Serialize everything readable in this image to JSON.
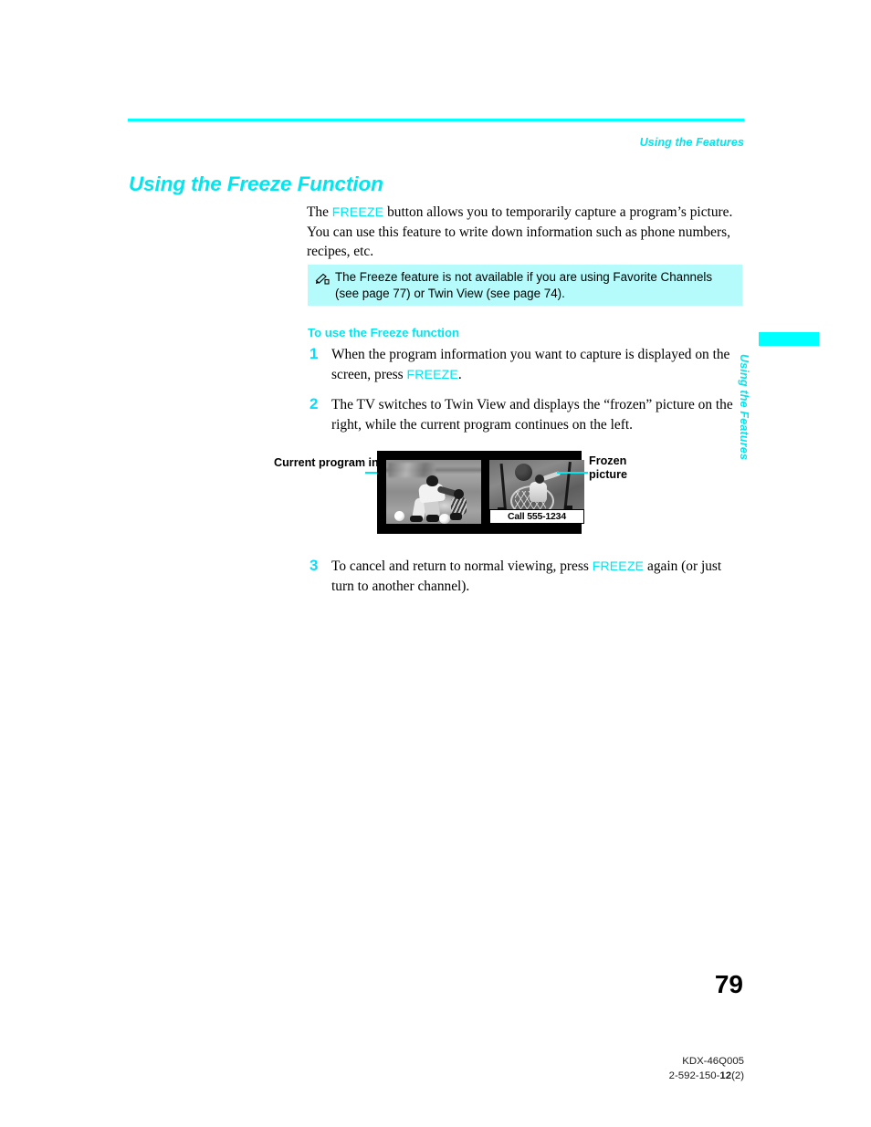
{
  "header": {
    "running_head": "Using the Features",
    "rule_color": "#00ffff"
  },
  "title": "Using the Freeze Function",
  "intro": {
    "part1": "The ",
    "keyword": "FREEZE",
    "part2": " button allows you to temporarily capture a program’s picture. You can use this feature to write down information such as phone numbers, recipes, etc."
  },
  "note": {
    "icon": "pencil-note-icon",
    "text": "The Freeze feature is not available if you are using Favorite Channels (see page 77) or Twin View (see page 74).",
    "background": "#b5fbfb"
  },
  "subhead": "To use the Freeze function",
  "steps": [
    {
      "number": "1",
      "text_before": "When the program information you want to capture is displayed on the screen, press ",
      "keyword": "FREEZE",
      "text_after": "."
    },
    {
      "number": "2",
      "text_before": "The TV switches to Twin View and displays the “frozen” picture on the right, while the current program continues on the left.",
      "keyword": "",
      "text_after": ""
    },
    {
      "number": "3",
      "text_before": "To cancel and return to normal viewing, press ",
      "keyword": "FREEZE",
      "text_after": " again (or just turn to another channel)."
    }
  ],
  "figure": {
    "callout_left": "Current program in progress",
    "callout_right": "Frozen picture",
    "caption": "Call 555-1234",
    "leader_color": "#00e5ee"
  },
  "thumb_tab": {
    "label": "Using the Features",
    "bar_color": "#00ffff"
  },
  "footer": {
    "page_number": "79",
    "model": "KDX-46Q005",
    "doc_prefix": "2-592-150-",
    "doc_bold": "12",
    "doc_suffix": "(2)"
  },
  "accent_color": "#00e5ee"
}
